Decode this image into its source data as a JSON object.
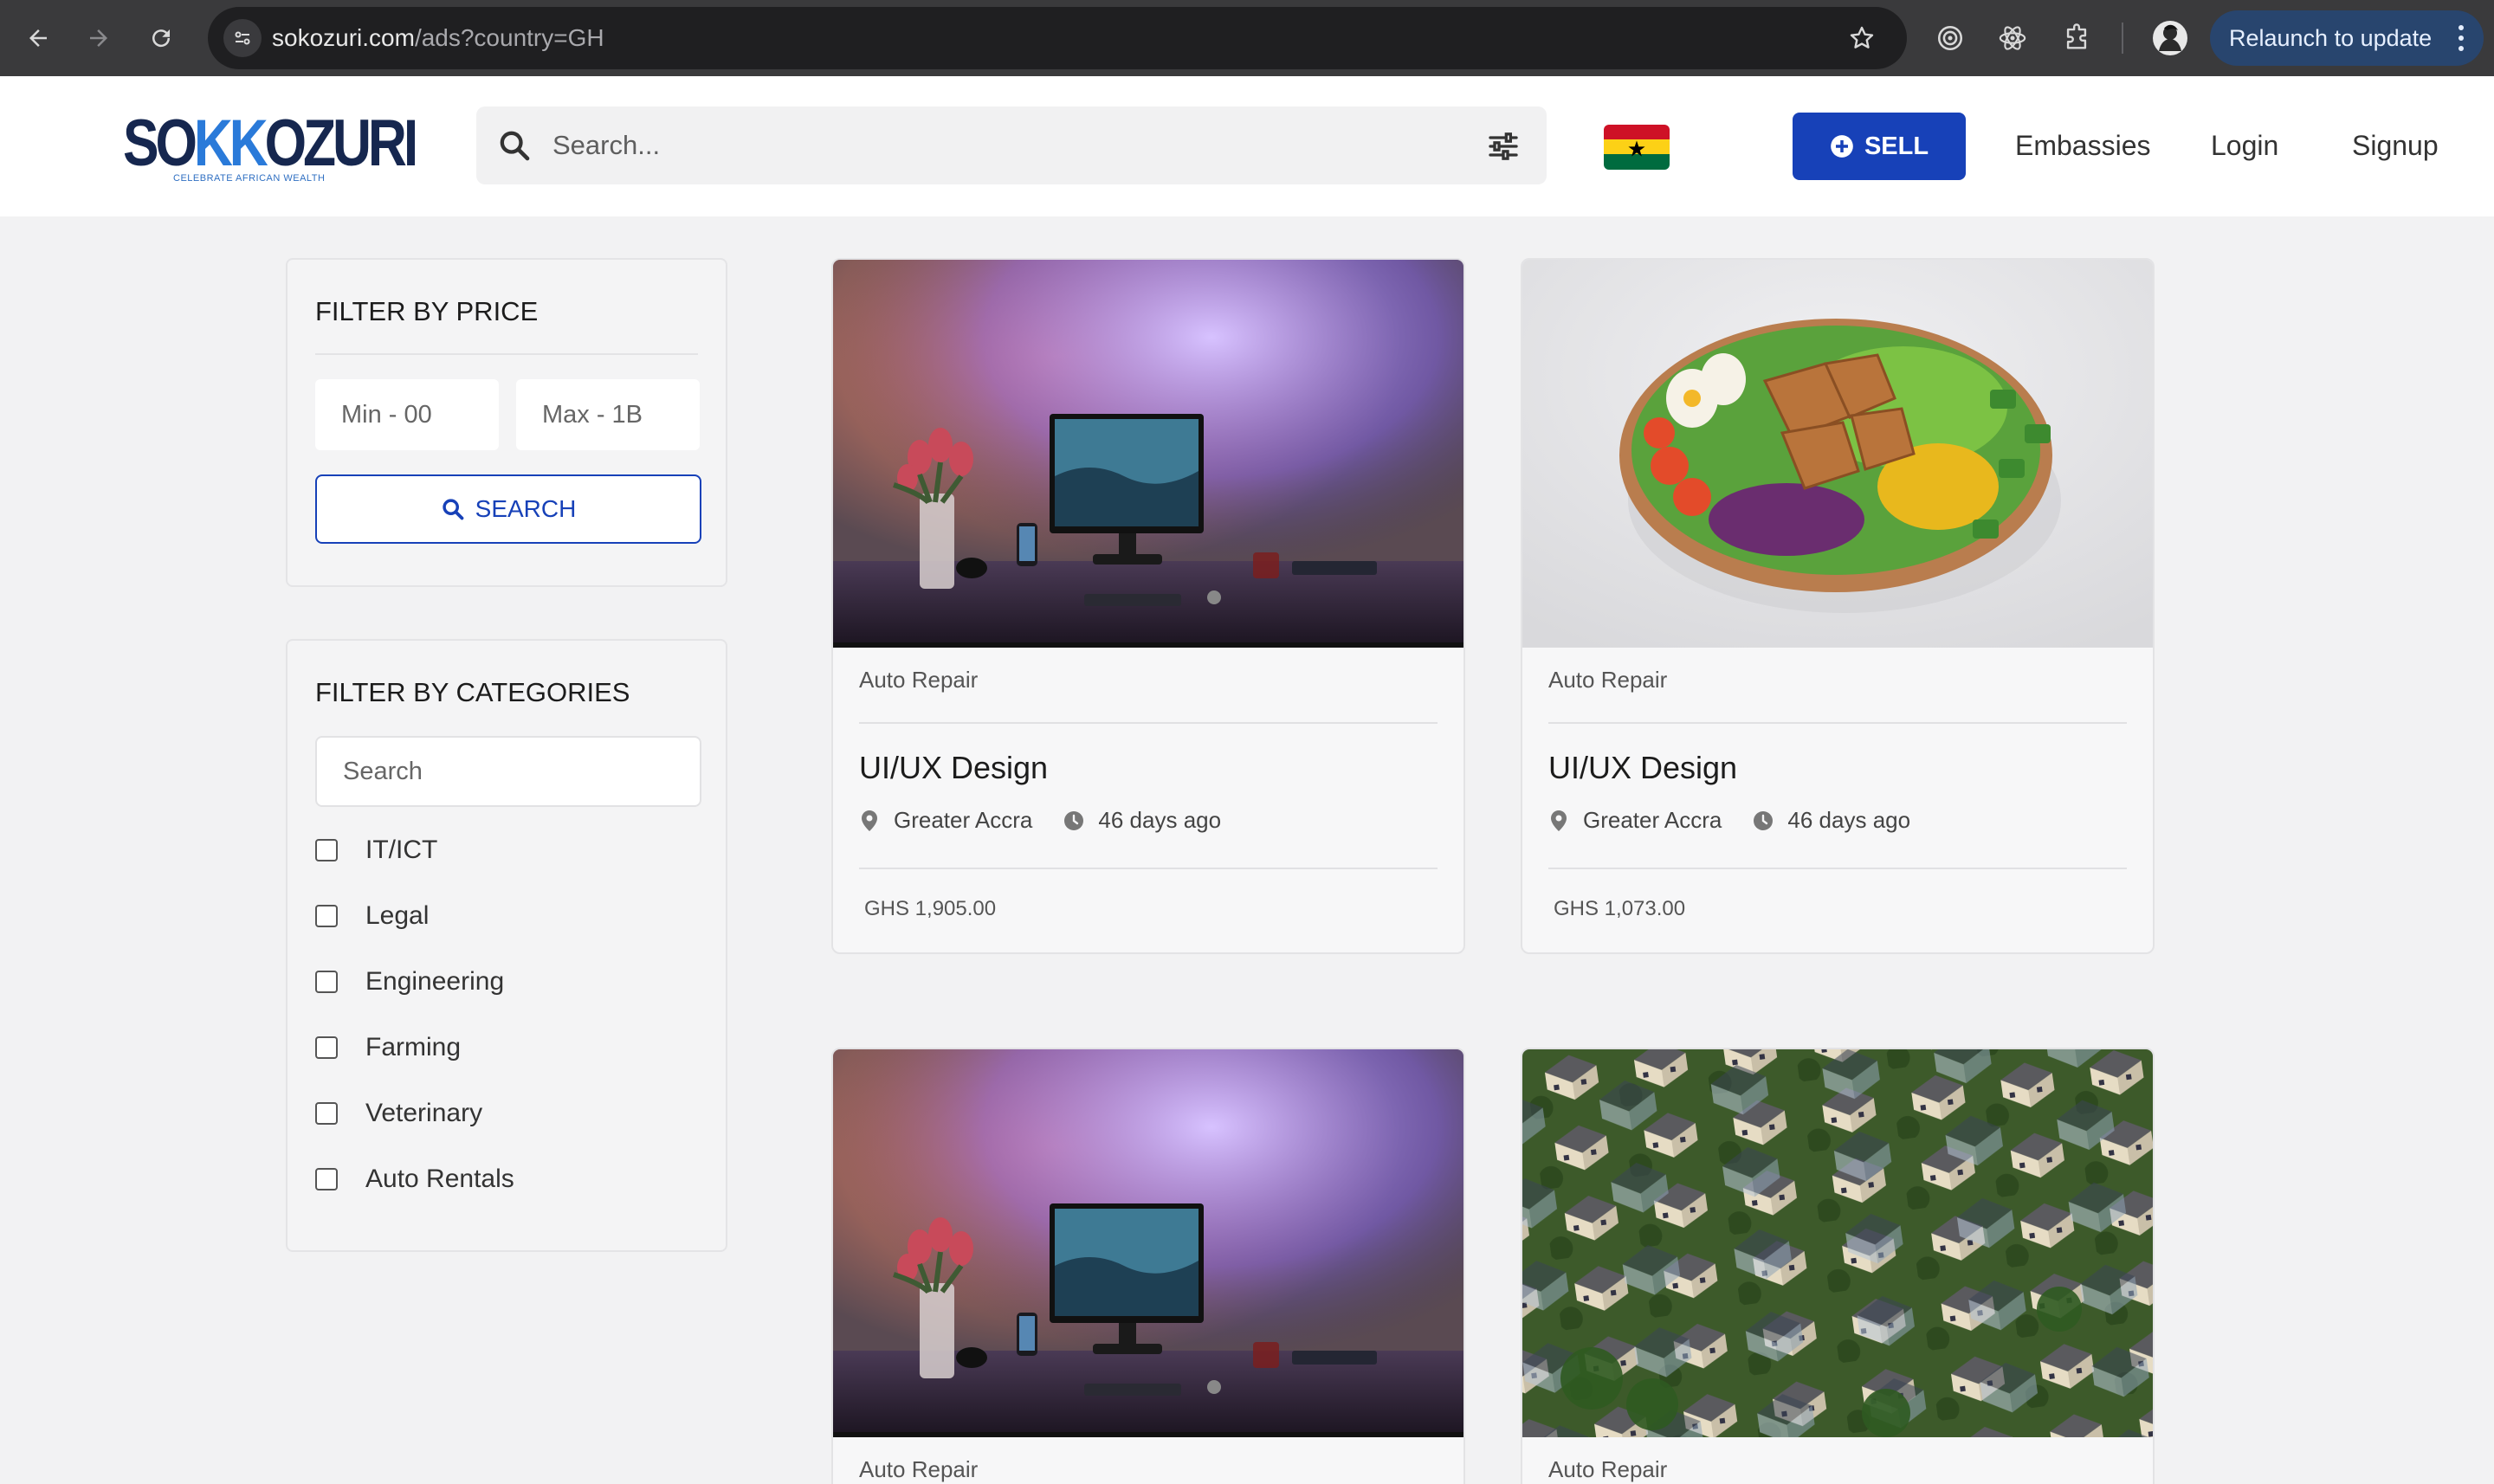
{
  "browser": {
    "url_host": "sokozuri.com",
    "url_path": "/ads?country=GH",
    "relaunch_label": "Relaunch to update",
    "icons": [
      "back-icon",
      "forward-icon",
      "reload-icon",
      "site-info-icon",
      "bookmark-star-icon",
      "extension-target-icon",
      "extension-react-icon",
      "extensions-puzzle-icon",
      "profile-avatar",
      "menu-dots-icon"
    ]
  },
  "header": {
    "logo_text_a": "SO",
    "logo_text_k": "KK",
    "logo_text_b": "OZURI",
    "logo_tagline": "CELEBRATE AFRICAN WEALTH",
    "search_placeholder": "Search...",
    "sell_label": "SELL",
    "nav": [
      "Embassies",
      "Login",
      "Signup"
    ],
    "colors": {
      "brand_blue": "#1741b8",
      "logo_navy": "#16274f"
    }
  },
  "price_filter": {
    "title": "FILTER BY PRICE",
    "min_placeholder": "Min - 00",
    "max_placeholder": "Max - 1B",
    "search_label": "SEARCH"
  },
  "category_filter": {
    "title": "FILTER BY CATEGORIES",
    "search_placeholder": "Search",
    "items": [
      "IT/ICT",
      "Legal",
      "Engineering",
      "Farming",
      "Veterinary",
      "Auto Rentals"
    ]
  },
  "listings": [
    {
      "category": "Auto Repair",
      "title": "UI/UX Design",
      "location": "Greater Accra",
      "posted": "46 days ago",
      "price": "GHS 1,905.00",
      "image": "desk-monitor-photo"
    },
    {
      "category": "Auto Repair",
      "title": "UI/UX Design",
      "location": "Greater Accra",
      "posted": "46 days ago",
      "price": "GHS 1,073.00",
      "image": "salad-bowl-photo"
    },
    {
      "category": "Auto Repair",
      "image": "desk-monitor-photo"
    },
    {
      "category": "Auto Repair",
      "image": "houses-aerial-photo"
    }
  ]
}
